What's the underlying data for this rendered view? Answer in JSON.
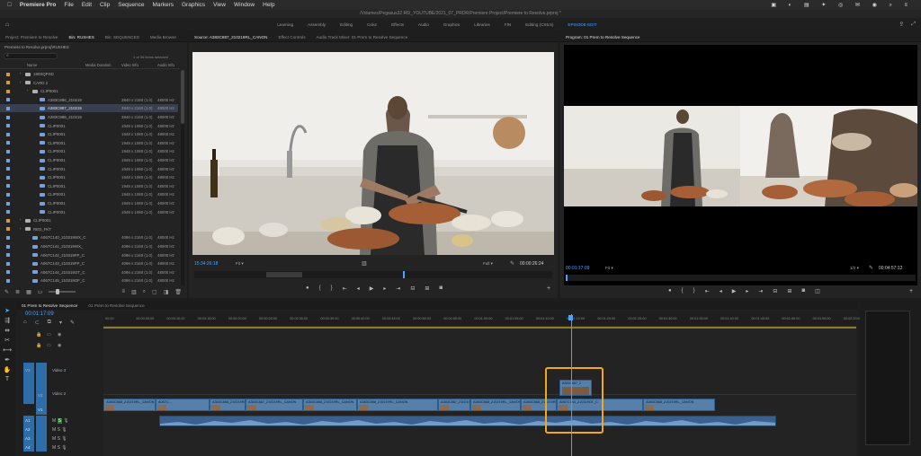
{
  "menubar": {
    "app": "Premiere Pro",
    "items": [
      "File",
      "Edit",
      "Clip",
      "Sequence",
      "Markers",
      "Graphics",
      "View",
      "Window",
      "Help"
    ]
  },
  "titlebar": {
    "path": "/Volumes/Pegasus32 R6/_YOUTUBE/2021_07_PRDR/Premiere Project/Premiere to Resolve.prproj *"
  },
  "workspaces": [
    "Learning",
    "Assembly",
    "Editing",
    "Color",
    "Effects",
    "Audio",
    "Graphics",
    "Libraries",
    "FIN",
    "Editing (CS5.5)"
  ],
  "workspace_active": "EPISODE EDIT",
  "project": {
    "tabs": [
      "Project: Premiere to Resolve",
      "Bin: RUSHES",
      "Bin: SEQUENCES",
      "Media Browse"
    ],
    "active_tab": "Bin: RUSHES",
    "path": "Premiere to Resolve.prproj\\RUSHES",
    "items_selected": "1 of 36 items selected",
    "columns": [
      "Name",
      "Media Duration",
      "Video Info",
      "Audio Info"
    ],
    "rows": [
      {
        "name": "180SQPSD",
        "w": "",
        "h": "",
        "type": "folder",
        "depth": 1,
        "color": "#d89a38"
      },
      {
        "name": "CARD 2",
        "w": "",
        "h": "",
        "type": "folder",
        "depth": 1,
        "color": "#d89a38"
      },
      {
        "name": "CLIP0001",
        "w": "",
        "h": "",
        "type": "folder",
        "depth": 2,
        "color": "#d89a38"
      },
      {
        "name": "A383C886_210219",
        "w": "3840 x 2160 (1.0)",
        "h": "48000 Hz",
        "type": "clip",
        "depth": 3,
        "color": "#7a9fd6"
      },
      {
        "name": "A383C887_210219",
        "w": "3840 x 2160 (1.0)",
        "h": "48000 Hz",
        "type": "clip",
        "depth": 3,
        "color": "#7a9fd6",
        "selected": true
      },
      {
        "name": "A383C888_210219",
        "w": "3840 x 2160 (1.0)",
        "h": "48000 Hz",
        "type": "clip",
        "depth": 3,
        "color": "#7a9fd6"
      },
      {
        "name": "CLIP0001",
        "w": "1948 x 1080 (1.0)",
        "h": "48000 Hz",
        "type": "clip",
        "depth": 3,
        "color": "#7a9fd6"
      },
      {
        "name": "CLIP0001",
        "w": "1948 x 1080 (1.0)",
        "h": "48000 Hz",
        "type": "clip",
        "depth": 3,
        "color": "#7a9fd6"
      },
      {
        "name": "CLIP0001",
        "w": "1948 x 1080 (1.0)",
        "h": "48000 Hz",
        "type": "clip",
        "depth": 3,
        "color": "#7a9fd6"
      },
      {
        "name": "CLIP0001",
        "w": "1948 x 1080 (1.0)",
        "h": "48000 Hz",
        "type": "clip",
        "depth": 3,
        "color": "#7a9fd6"
      },
      {
        "name": "CLIP0001",
        "w": "1948 x 1080 (1.0)",
        "h": "48000 Hz",
        "type": "clip",
        "depth": 3,
        "color": "#7a9fd6"
      },
      {
        "name": "CLIP0001",
        "w": "1948 x 1080 (1.0)",
        "h": "48000 Hz",
        "type": "clip",
        "depth": 3,
        "color": "#7a9fd6"
      },
      {
        "name": "CLIP0001",
        "w": "1948 x 1080 (1.0)",
        "h": "48000 Hz",
        "type": "clip",
        "depth": 3,
        "color": "#7a9fd6"
      },
      {
        "name": "CLIP0001",
        "w": "1948 x 1080 (1.0)",
        "h": "48000 Hz",
        "type": "clip",
        "depth": 3,
        "color": "#7a9fd6"
      },
      {
        "name": "CLIP0001",
        "w": "1948 x 1080 (1.0)",
        "h": "48000 Hz",
        "type": "clip",
        "depth": 3,
        "color": "#7a9fd6"
      },
      {
        "name": "CLIP0001",
        "w": "1948 x 1080 (1.0)",
        "h": "48000 Hz",
        "type": "clip",
        "depth": 3,
        "color": "#7a9fd6"
      },
      {
        "name": "CLIP0001",
        "w": "1948 x 1080 (1.0)",
        "h": "48000 Hz",
        "type": "clip",
        "depth": 3,
        "color": "#7a9fd6"
      },
      {
        "name": "CLIP0001",
        "w": "",
        "h": "",
        "type": "folder",
        "depth": 1,
        "color": "#d89a38"
      },
      {
        "name": "RED_FKT",
        "w": "",
        "h": "",
        "type": "folder",
        "depth": 1,
        "color": "#d89a38"
      },
      {
        "name": "A067C140_210319WX_C",
        "w": "4096 x 2160 (1.0)",
        "h": "48000 Hz",
        "type": "clip",
        "depth": 2,
        "color": "#7a9fd6"
      },
      {
        "name": "A067C141_210319WX_",
        "w": "4096 x 2160 (1.0)",
        "h": "48000 Hz",
        "type": "clip",
        "depth": 2,
        "color": "#7a9fd6"
      },
      {
        "name": "A067C142_210319FP_C",
        "w": "4096 x 2160 (1.0)",
        "h": "48000 Hz",
        "type": "clip",
        "depth": 2,
        "color": "#7a9fd6"
      },
      {
        "name": "A067C143_210319FP_C",
        "w": "4096 x 2160 (1.0)",
        "h": "48000 Hz",
        "type": "clip",
        "depth": 2,
        "color": "#7a9fd6"
      },
      {
        "name": "A067C144_210319OT_C",
        "w": "4096 x 2160 (1.0)",
        "h": "48000 Hz",
        "type": "clip",
        "depth": 2,
        "color": "#7a9fd6"
      },
      {
        "name": "A067C145_210319OF_C",
        "w": "4096 x 2160 (1.0)",
        "h": "48000 Hz",
        "type": "clip",
        "depth": 2,
        "color": "#7a9fd6"
      }
    ]
  },
  "source": {
    "tabs": [
      "Source: A383C887_210219RL_CANON",
      "Effect Controls",
      "Audio Track Mixer: 01 Prem to Resolve Sequence"
    ],
    "timecode": "15:34:26:18",
    "fit": "Fit",
    "res": "Full",
    "duration": "00:00:26:24"
  },
  "program": {
    "tab": "Program: 01 Prem to Resolve Sequence",
    "timecode": "00:01:17:09",
    "fit": "Fit",
    "res": "1/2",
    "duration": "00:04:57:12"
  },
  "timeline": {
    "tabs": [
      "01 Prem to Resolve Sequence",
      "01 Prem to Resolve Sequence"
    ],
    "timecode": "00:01:17:09",
    "ruler": [
      "00:00",
      "00:00:05:00",
      "00:00:10:00",
      "00:00:15:00",
      "00:00:20:00",
      "00:00:25:00",
      "00:00:30:00",
      "00:00:35:00",
      "00:00:40:00",
      "00:00:45:00",
      "00:00:50:00",
      "00:00:55:00",
      "00:01:00:00",
      "00:01:05:00",
      "00:01:10:00",
      "00:01:15:00",
      "00:01:20:00",
      "00:01:25:00",
      "00:01:30:00",
      "00:01:35:00",
      "00:01:40:00",
      "00:01:45:00",
      "00:01:50:00",
      "00:01:55:00",
      "00:02:00:00"
    ],
    "track_labels": {
      "v3": "V3",
      "v2": "V2",
      "v1": "V1",
      "video3": "Video 3",
      "video2": "Video 2",
      "a1": "A1",
      "a2": "A2",
      "a3": "A3",
      "a4": "A4"
    },
    "clips_v1": [
      "A383C888_210219RL_CANON",
      "A067C...",
      "A383C888_210219RL_CANON",
      "A383C887_210219RL_CANON",
      "A383C888_210219RL_CANON",
      "A383C888_210219RL_CANON",
      "A383C887_210219RL_CANON",
      "A383C888_210219RL_CANON",
      "A383C888_210219RL_CANON",
      "A067C144_210319OT_C",
      "A383C888_210219RL_CANON"
    ],
    "clip_v2": "A383C887_2"
  },
  "colors": {
    "highlight": "#f2a81d",
    "playhead": "#4aa3ff",
    "clip_blue": "#5680aa"
  }
}
